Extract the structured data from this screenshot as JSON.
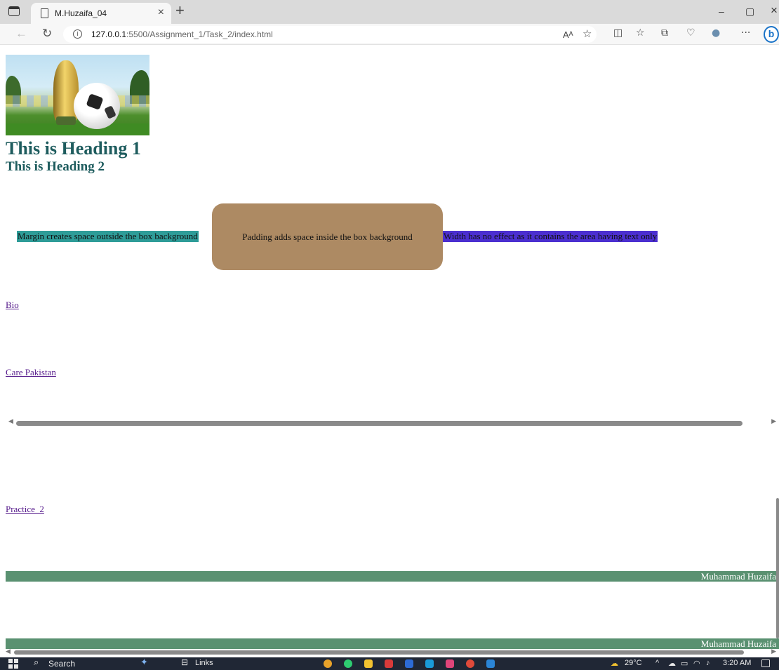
{
  "browser": {
    "tab_title": "M.Huzaifa_04",
    "tab_close": "×",
    "new_tab": "+",
    "url_host": "127.0.0.1",
    "url_path": ":5500/Assignment_1/Task_2/index.html",
    "minimize": "–",
    "restore": "▢",
    "close": "×",
    "read_aloud": "Aᴬ",
    "more": "···",
    "bing": "b"
  },
  "page": {
    "heading1": "This is Heading 1",
    "heading2": "This is Heading 2",
    "box_margin_text": "Margin creates space outside the box background",
    "box_padding_text": "Padding adds space inside the box background",
    "box_width_text": "Width has no effect as it contains the area having text only",
    "links": [
      {
        "label": "Bio"
      },
      {
        "label": "Care Pakistan"
      },
      {
        "label": "Practice_2"
      }
    ],
    "footer_name_1": "Muhammad Huzaifa",
    "footer_name_2": "Muhammad Huzaifa"
  },
  "taskbar": {
    "search_label": "Search",
    "links_label": "Links",
    "temperature": "29°C",
    "time": "3:20 AM"
  },
  "colors": {
    "heading": "#1e5c5e",
    "margin_box": "#2e9c98",
    "padding_box": "#ad8a63",
    "width_box": "#4b2fd0",
    "footer_bar": "#5a9171",
    "link": "#551a8b"
  }
}
